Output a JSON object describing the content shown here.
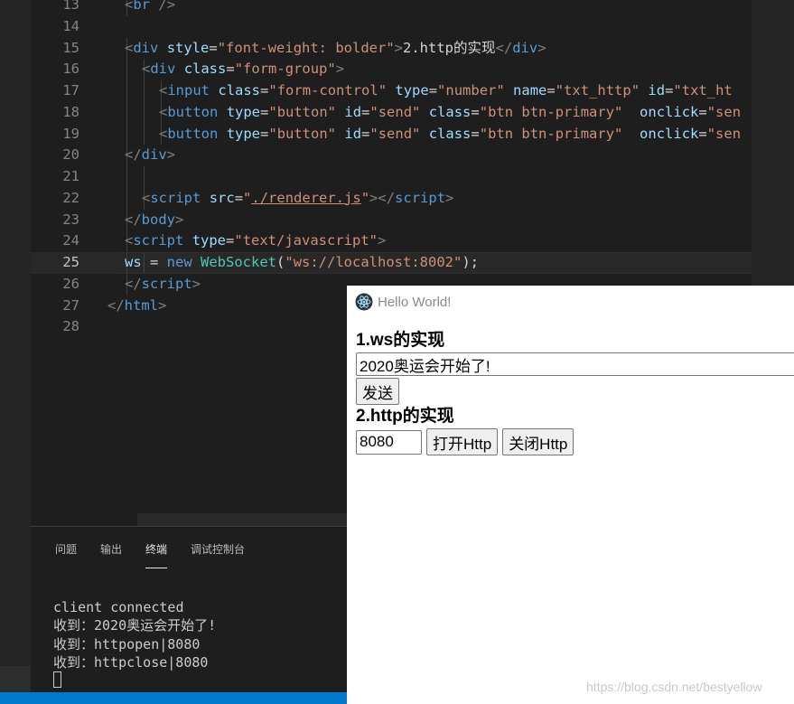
{
  "editor": {
    "current_line": "25",
    "lines": [
      {
        "n": "13",
        "parts": [
          [
            "p",
            "<"
          ],
          [
            "t",
            "br"
          ],
          [
            "",
            " "
          ],
          [
            "p",
            "/>"
          ]
        ]
      },
      {
        "n": "14",
        "parts": []
      },
      {
        "n": "15",
        "parts": [
          [
            "p",
            "<"
          ],
          [
            "t",
            "div"
          ],
          [
            "",
            " "
          ],
          [
            "a",
            "style"
          ],
          [
            "",
            "="
          ],
          [
            "s",
            "\"font-weight: bolder\""
          ],
          [
            "p",
            ">"
          ],
          [
            "",
            "2.http的实现"
          ],
          [
            "p",
            "</"
          ],
          [
            "t",
            "div"
          ],
          [
            "p",
            ">"
          ]
        ]
      },
      {
        "n": "16",
        "parts": [
          [
            "p",
            "<"
          ],
          [
            "t",
            "div"
          ],
          [
            "",
            " "
          ],
          [
            "a",
            "class"
          ],
          [
            "",
            "="
          ],
          [
            "s",
            "\"form-group\""
          ],
          [
            "p",
            ">"
          ]
        ]
      },
      {
        "n": "17",
        "parts": [
          [
            "p",
            "<"
          ],
          [
            "t",
            "input"
          ],
          [
            "",
            " "
          ],
          [
            "a",
            "class"
          ],
          [
            "",
            "="
          ],
          [
            "s",
            "\"form-control\""
          ],
          [
            "",
            " "
          ],
          [
            "a",
            "type"
          ],
          [
            "",
            "="
          ],
          [
            "s",
            "\"number\""
          ],
          [
            "",
            " "
          ],
          [
            "a",
            "name"
          ],
          [
            "",
            "="
          ],
          [
            "s",
            "\"txt_http\""
          ],
          [
            "",
            " "
          ],
          [
            "a",
            "id"
          ],
          [
            "",
            "="
          ],
          [
            "s",
            "\"txt_ht"
          ]
        ]
      },
      {
        "n": "18",
        "parts": [
          [
            "p",
            "<"
          ],
          [
            "t",
            "button"
          ],
          [
            "",
            " "
          ],
          [
            "a",
            "type"
          ],
          [
            "",
            "="
          ],
          [
            "s",
            "\"button\""
          ],
          [
            "",
            " "
          ],
          [
            "a",
            "id"
          ],
          [
            "",
            "="
          ],
          [
            "s",
            "\"send\""
          ],
          [
            "",
            " "
          ],
          [
            "a",
            "class"
          ],
          [
            "",
            "="
          ],
          [
            "s",
            "\"btn btn-primary\""
          ],
          [
            "",
            "  "
          ],
          [
            "a",
            "onclick"
          ],
          [
            "",
            "="
          ],
          [
            "s",
            "\"sen"
          ]
        ]
      },
      {
        "n": "19",
        "parts": [
          [
            "p",
            "<"
          ],
          [
            "t",
            "button"
          ],
          [
            "",
            " "
          ],
          [
            "a",
            "type"
          ],
          [
            "",
            "="
          ],
          [
            "s",
            "\"button\""
          ],
          [
            "",
            " "
          ],
          [
            "a",
            "id"
          ],
          [
            "",
            "="
          ],
          [
            "s",
            "\"send\""
          ],
          [
            "",
            " "
          ],
          [
            "a",
            "class"
          ],
          [
            "",
            "="
          ],
          [
            "s",
            "\"btn btn-primary\""
          ],
          [
            "",
            "  "
          ],
          [
            "a",
            "onclick"
          ],
          [
            "",
            "="
          ],
          [
            "s",
            "\"sen"
          ]
        ]
      },
      {
        "n": "20",
        "parts": [
          [
            "p",
            "</"
          ],
          [
            "t",
            "div"
          ],
          [
            "p",
            ">"
          ]
        ]
      },
      {
        "n": "21",
        "parts": []
      },
      {
        "n": "22",
        "parts": [
          [
            "p",
            "<"
          ],
          [
            "t",
            "script"
          ],
          [
            "",
            " "
          ],
          [
            "a",
            "src"
          ],
          [
            "",
            "="
          ],
          [
            "s",
            "\""
          ],
          [
            "su",
            "./renderer.js"
          ],
          [
            "s",
            "\""
          ],
          [
            "p",
            "></"
          ],
          [
            "t",
            "script"
          ],
          [
            "p",
            ">"
          ]
        ]
      },
      {
        "n": "23",
        "parts": [
          [
            "p",
            "</"
          ],
          [
            "t",
            "body"
          ],
          [
            "p",
            ">"
          ]
        ]
      },
      {
        "n": "24",
        "parts": [
          [
            "p",
            "<"
          ],
          [
            "t",
            "script"
          ],
          [
            "",
            " "
          ],
          [
            "a",
            "type"
          ],
          [
            "",
            "="
          ],
          [
            "s",
            "\"text/javascript\""
          ],
          [
            "p",
            ">"
          ]
        ]
      },
      {
        "n": "25",
        "parts": [
          [
            "a",
            "ws"
          ],
          [
            "",
            " = "
          ],
          [
            "t",
            "new"
          ],
          [
            "",
            " "
          ],
          [
            "c",
            "WebSocket"
          ],
          [
            "",
            "("
          ],
          [
            "s",
            "\"ws://localhost:8002\""
          ],
          [
            "",
            ");"
          ]
        ]
      },
      {
        "n": "26",
        "parts": [
          [
            "p",
            "</"
          ],
          [
            "t",
            "script"
          ],
          [
            "p",
            ">"
          ]
        ]
      },
      {
        "n": "27",
        "parts": [
          [
            "p",
            "</"
          ],
          [
            "t",
            "html"
          ],
          [
            "p",
            ">"
          ]
        ]
      },
      {
        "n": "28",
        "parts": []
      }
    ]
  },
  "panel": {
    "tabs": [
      {
        "label": "问题",
        "active": false
      },
      {
        "label": "输出",
        "active": false
      },
      {
        "label": "终端",
        "active": true
      },
      {
        "label": "调试控制台",
        "active": false
      }
    ],
    "terminal_lines": [
      "client connected",
      "收到：2020奥运会开始了!",
      "收到：httpopen|8080",
      "收到：httpclose|8080"
    ]
  },
  "app": {
    "title": "Hello World!",
    "ws_heading": "1.ws的实现",
    "ws_input_value": "2020奥运会开始了!",
    "send_label": "发送",
    "http_heading": "2.http的实现",
    "http_port_value": "8080",
    "open_http_label": "打开Http",
    "close_http_label": "关闭Http"
  },
  "watermark": "https://blog.csdn.net/bestyellow"
}
